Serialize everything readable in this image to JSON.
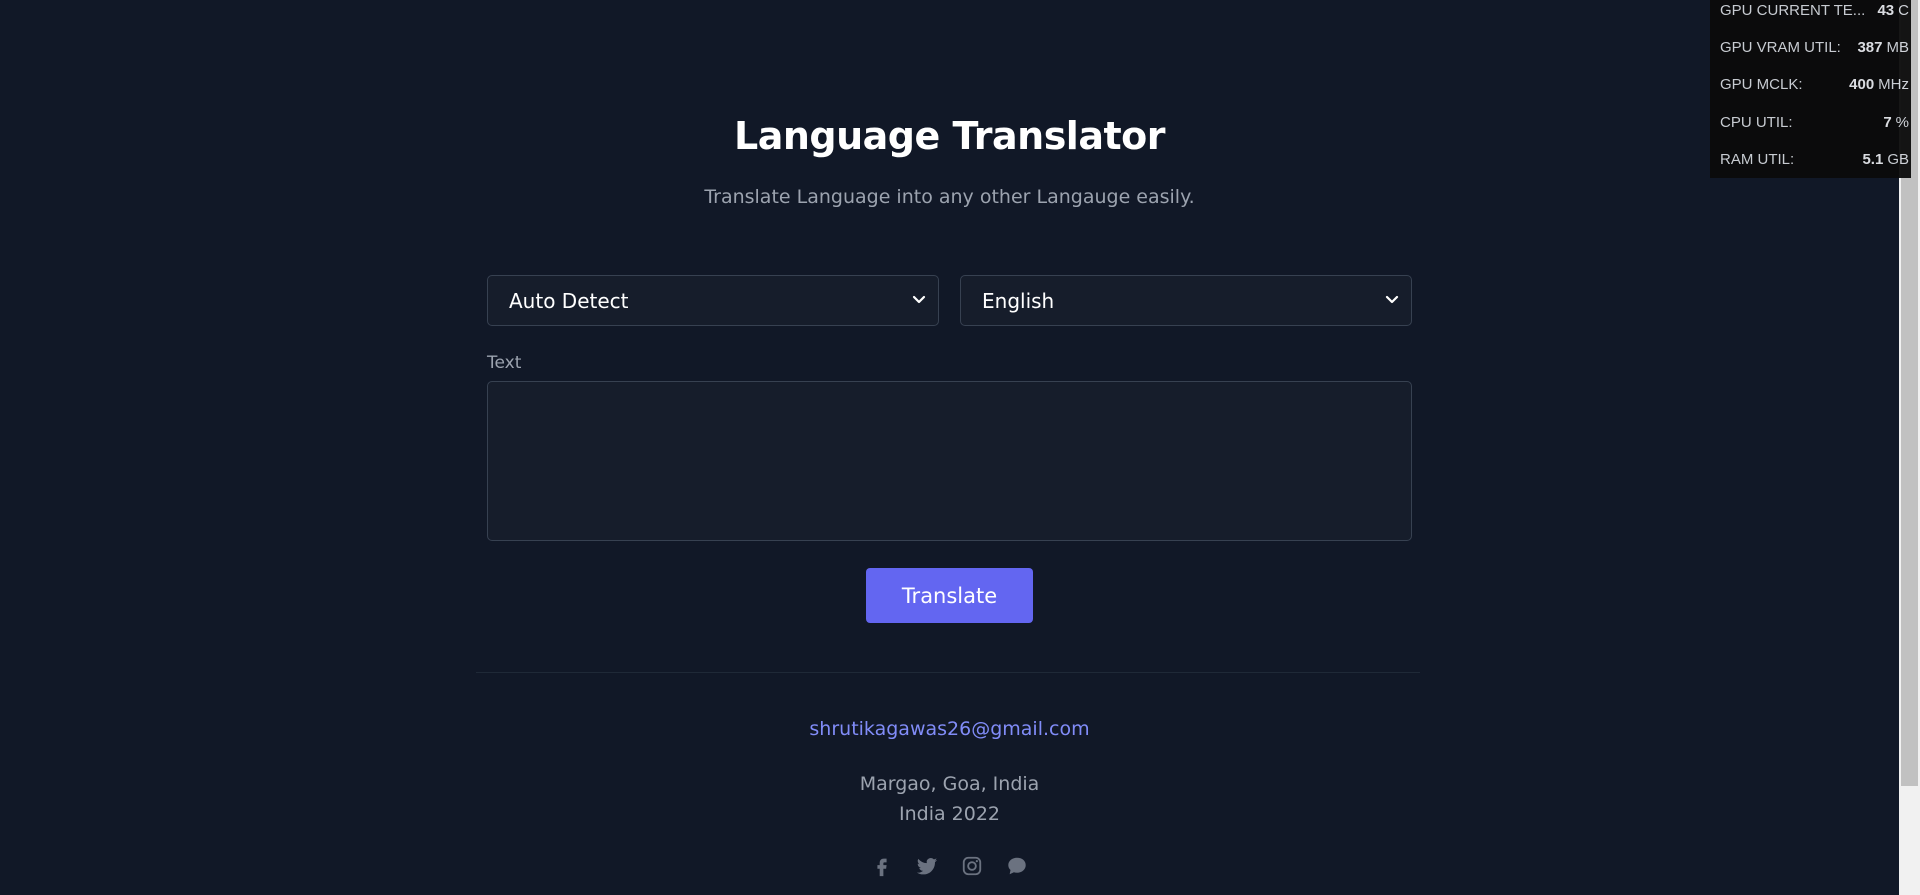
{
  "header": {
    "title": "Language Translator",
    "subtitle": "Translate Language into any other Langauge easily."
  },
  "form": {
    "source_language": "Auto Detect",
    "target_language": "English",
    "text_label": "Text",
    "text_value": "",
    "translate_label": "Translate"
  },
  "footer": {
    "email": "shrutikagawas26@gmail.com",
    "location": "Margao, Goa, India",
    "year_line": "India 2022",
    "socials": [
      "facebook-icon",
      "twitter-icon",
      "instagram-icon",
      "chat-icon"
    ]
  },
  "monitor": {
    "rows": [
      {
        "label": "GPU CURRENT TE...",
        "value": "43",
        "unit": "C"
      },
      {
        "label": "GPU VRAM UTIL:",
        "value": "387",
        "unit": "MB"
      },
      {
        "label": "GPU MCLK:",
        "value": "400",
        "unit": "MHz"
      },
      {
        "label": "CPU UTIL:",
        "value": "7",
        "unit": "%"
      },
      {
        "label": "RAM UTIL:",
        "value": "5.1",
        "unit": "GB"
      }
    ]
  },
  "colors": {
    "background": "#111827",
    "accent": "#6366f1",
    "link": "#818cf8",
    "muted_text": "#9ca3af"
  }
}
